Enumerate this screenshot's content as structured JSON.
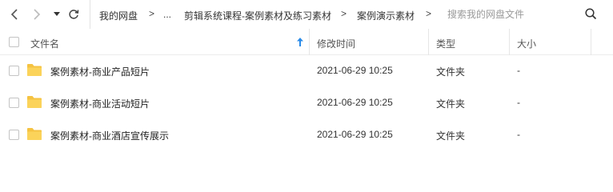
{
  "breadcrumb": {
    "items": [
      "我的网盘",
      "...",
      "剪辑系统课程-案例素材及练习素材",
      "案例演示素材"
    ],
    "separator": ">"
  },
  "search": {
    "placeholder": "搜索我的网盘文件"
  },
  "table": {
    "columns": {
      "name": "文件名",
      "modified": "修改时间",
      "type": "类型",
      "size": "大小"
    },
    "rows": [
      {
        "name": "案例素材-商业产品短片",
        "modified": "2021-06-29 10:25",
        "type": "文件夹",
        "size": "-"
      },
      {
        "name": "案例素材-商业活动短片",
        "modified": "2021-06-29 10:25",
        "type": "文件夹",
        "size": "-"
      },
      {
        "name": "案例素材-商业酒店宣传展示",
        "modified": "2021-06-29 10:25",
        "type": "文件夹",
        "size": "-"
      }
    ]
  },
  "icons": {
    "back": "chevron-left-icon",
    "forward": "chevron-right-icon",
    "dropdown": "caret-down-icon",
    "refresh": "refresh-icon",
    "search": "search-icon",
    "sort": "sort-arrow-up-icon",
    "folder": "folder-icon"
  },
  "colors": {
    "folder": "#f5c342",
    "sort_arrow": "#2a8be8",
    "disabled_nav": "#bbbbbb"
  }
}
